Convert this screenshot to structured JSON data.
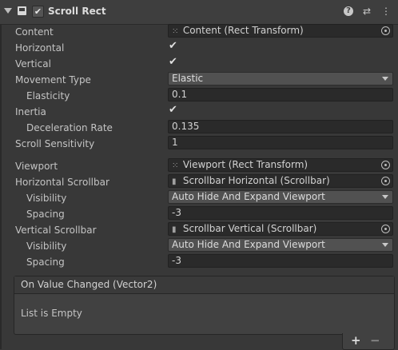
{
  "header": {
    "title": "Scroll Rect",
    "enabled_check": "✔",
    "help_icon": "?",
    "presets_icon": "⇄",
    "menu_icon": "⋮"
  },
  "fields": {
    "content": {
      "label": "Content",
      "value": "Content (Rect Transform)"
    },
    "horizontal": {
      "label": "Horizontal",
      "value": "✔"
    },
    "vertical": {
      "label": "Vertical",
      "value": "✔"
    },
    "movement_type": {
      "label": "Movement Type",
      "value": "Elastic"
    },
    "elasticity": {
      "label": "Elasticity",
      "value": "0.1"
    },
    "inertia": {
      "label": "Inertia",
      "value": "✔"
    },
    "deceleration_rate": {
      "label": "Deceleration Rate",
      "value": "0.135"
    },
    "scroll_sensitivity": {
      "label": "Scroll Sensitivity",
      "value": "1"
    },
    "viewport": {
      "label": "Viewport",
      "value": "Viewport (Rect Transform)"
    },
    "horizontal_scrollbar": {
      "label": "Horizontal Scrollbar",
      "value": "Scrollbar Horizontal (Scrollbar)"
    },
    "h_visibility": {
      "label": "Visibility",
      "value": "Auto Hide And Expand Viewport"
    },
    "h_spacing": {
      "label": "Spacing",
      "value": "-3"
    },
    "vertical_scrollbar": {
      "label": "Vertical Scrollbar",
      "value": "Scrollbar Vertical (Scrollbar)"
    },
    "v_visibility": {
      "label": "Visibility",
      "value": "Auto Hide And Expand Viewport"
    },
    "v_spacing": {
      "label": "Spacing",
      "value": "-3"
    }
  },
  "event": {
    "title": "On Value Changed (Vector2)",
    "empty_text": "List is Empty",
    "add_label": "+",
    "remove_label": "−"
  },
  "icons": {
    "rect_transform": "⁙",
    "scrollbar": "▮"
  }
}
